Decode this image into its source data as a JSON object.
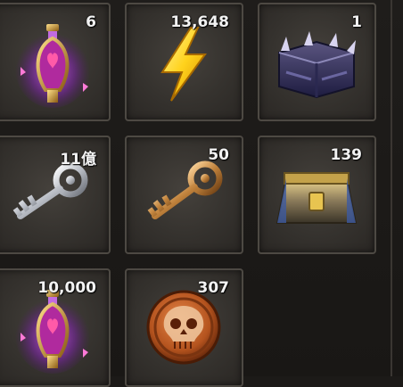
{
  "inventory": {
    "slots": [
      {
        "icon": "purple-potion-icon",
        "count": "6"
      },
      {
        "icon": "lightning-bolt-icon",
        "count": "13,648"
      },
      {
        "icon": "dark-spiked-chest-icon",
        "count": "1"
      },
      {
        "icon": "silver-key-icon",
        "count": "11億"
      },
      {
        "icon": "bronze-key-icon",
        "count": "50"
      },
      {
        "icon": "gold-chest-icon",
        "count": "139"
      },
      {
        "icon": "purple-potion-icon",
        "count": "10,000"
      },
      {
        "icon": "skull-coin-icon",
        "count": "307"
      }
    ]
  }
}
